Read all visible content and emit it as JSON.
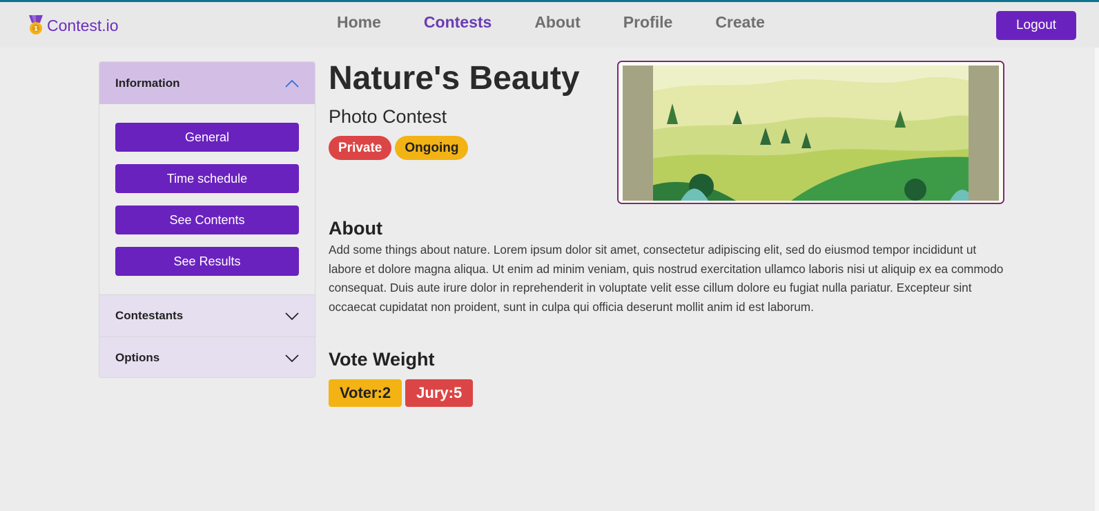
{
  "brand": {
    "name": "Contest.io",
    "icon": "medal-icon"
  },
  "nav": {
    "links": [
      {
        "label": "Home",
        "active": false
      },
      {
        "label": "Contests",
        "active": true
      },
      {
        "label": "About",
        "active": false
      },
      {
        "label": "Profile",
        "active": false
      },
      {
        "label": "Create",
        "active": false
      }
    ],
    "logout_label": "Logout"
  },
  "sidebar": {
    "information": {
      "title": "Information",
      "expanded": true,
      "buttons": [
        "General",
        "Time schedule",
        "See Contents",
        "See Results"
      ]
    },
    "contestants": {
      "title": "Contestants",
      "expanded": false
    },
    "options": {
      "title": "Options",
      "expanded": false
    }
  },
  "contest": {
    "title": "Nature's Beauty",
    "type": "Photo Contest",
    "badges": {
      "visibility": "Private",
      "status": "Ongoing"
    },
    "about_heading": "About",
    "about_text": "Add some things about nature. Lorem ipsum dolor sit amet, consectetur adipiscing elit, sed do eiusmod tempor incididunt ut labore et dolore magna aliqua. Ut enim ad minim veniam, quis nostrud exercitation ullamco laboris nisi ut aliquip ex ea commodo consequat. Duis aute irure dolor in reprehenderit in voluptate velit esse cillum dolore eu fugiat nulla pariatur. Excepteur sint occaecat cupidatat non proident, sunt in culpa qui officia deserunt mollit anim id est laborum.",
    "vote_heading": "Vote Weight",
    "voter_weight": "Voter:2",
    "jury_weight": "Jury:5"
  },
  "colors": {
    "primary": "#6a22bf",
    "accent_text": "#6a3cb4",
    "danger": "#dc4545",
    "warning": "#f3b315",
    "accordion_open": "#d3bfe6"
  }
}
